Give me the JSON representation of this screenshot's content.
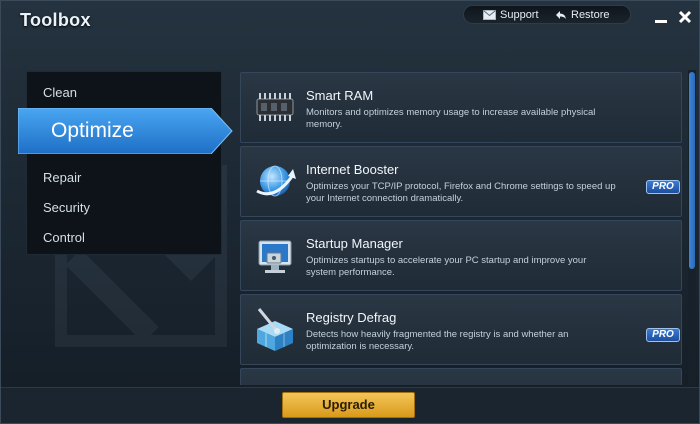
{
  "window": {
    "title": "Toolbox"
  },
  "topbar": {
    "support_label": "Support",
    "support_icon": "envelope-icon",
    "restore_label": "Restore",
    "restore_icon": "back-arrow-icon"
  },
  "window_controls": [
    "minimize-icon",
    "close-icon"
  ],
  "sidebar": {
    "items": [
      {
        "label": "Clean",
        "active": false
      },
      {
        "label": "Optimize",
        "active": true
      },
      {
        "label": "Repair",
        "active": false
      },
      {
        "label": "Security",
        "active": false
      },
      {
        "label": "Control",
        "active": false
      }
    ]
  },
  "tools": [
    {
      "title": "Smart RAM",
      "description": "Monitors and optimizes memory usage to increase available physical memory.",
      "icon": "memory-chip-icon",
      "pro": false
    },
    {
      "title": "Internet Booster",
      "description": "Optimizes your TCP/IP protocol, Firefox and Chrome settings to speed up your Internet connection dramatically.",
      "icon": "globe-icon",
      "pro": true
    },
    {
      "title": "Startup Manager",
      "description": "Optimizes startups to accelerate your PC startup and improve your system performance.",
      "icon": "monitor-icon",
      "pro": false
    },
    {
      "title": "Registry Defrag",
      "description": "Detects how heavily fragmented the registry is and whether an optimization is necessary.",
      "icon": "registry-cube-icon",
      "pro": true
    }
  ],
  "pro_badge_label": "PRO",
  "upgrade_label": "Upgrade",
  "colors": {
    "accent": "#2f8be0",
    "upgrade": "#e8b53a",
    "background": "#1c2833"
  }
}
